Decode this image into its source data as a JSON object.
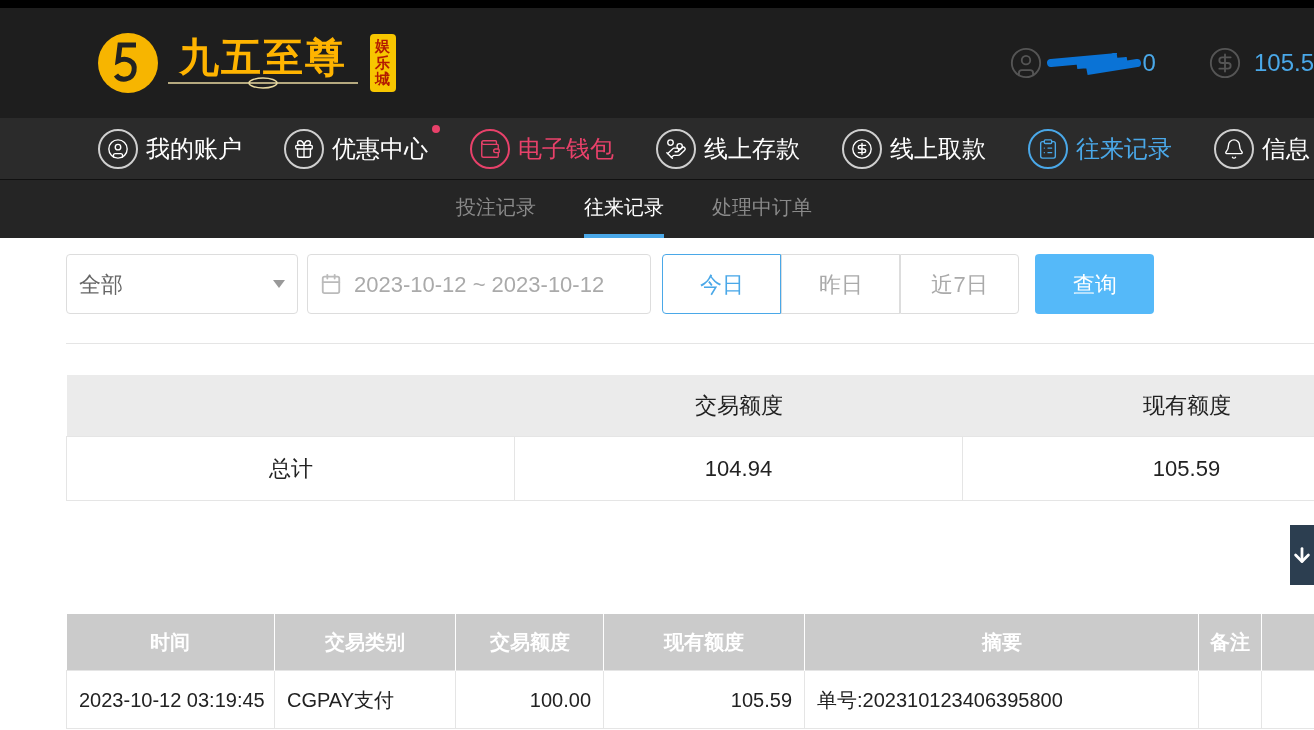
{
  "header": {
    "logo": {
      "title": "九五至尊",
      "badge": "娱乐城"
    },
    "user": {
      "name": "0"
    },
    "balance": "105.5"
  },
  "nav": [
    {
      "label": "我的账户",
      "color": "#ffffff",
      "badge": false
    },
    {
      "label": "优惠中心",
      "color": "#ffffff",
      "badge": true
    },
    {
      "label": "电子钱包",
      "color": "#e8416a",
      "badge": false
    },
    {
      "label": "线上存款",
      "color": "#ffffff",
      "badge": false
    },
    {
      "label": "线上取款",
      "color": "#ffffff",
      "badge": false
    },
    {
      "label": "往来记录",
      "color": "#4aa8e8",
      "badge": false
    },
    {
      "label": "信息",
      "color": "#ffffff",
      "badge": false
    }
  ],
  "subtabs": [
    {
      "label": "投注记录",
      "selected": false
    },
    {
      "label": "往来记录",
      "selected": true
    },
    {
      "label": "处理中订单",
      "selected": false
    }
  ],
  "filter": {
    "type_select": "全部",
    "date_range": "2023-10-12 ~ 2023-10-12",
    "quick": [
      {
        "label": "今日",
        "selected": true
      },
      {
        "label": "昨日",
        "selected": false
      },
      {
        "label": "近7日",
        "selected": false
      }
    ],
    "query_button": "查询"
  },
  "summary": {
    "columns": [
      "",
      "交易额度",
      "现有额度"
    ],
    "rows": [
      [
        "总计",
        "104.94",
        "105.59"
      ]
    ]
  },
  "records": {
    "columns": [
      "时间",
      "交易类别",
      "交易额度",
      "现有额度",
      "摘要",
      "备注"
    ],
    "rows": [
      [
        "2023-10-12 03:19:45",
        "CGPAY支付",
        "100.00",
        "105.59",
        "单号:202310123406395800",
        ""
      ]
    ]
  }
}
